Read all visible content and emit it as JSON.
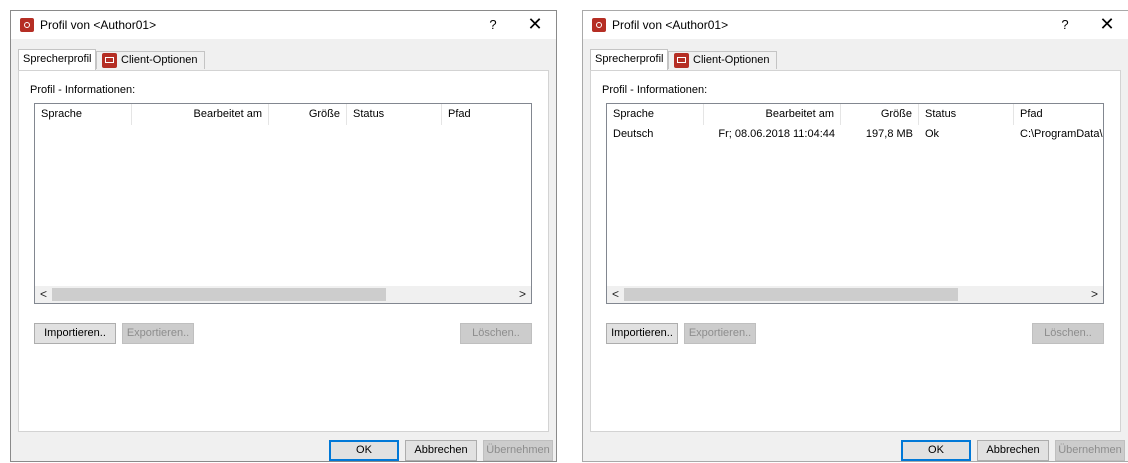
{
  "dialogs": [
    {
      "title": "Profil von <Author01>",
      "help_label": "?",
      "close_label": "✕",
      "tabs": [
        "Sprecherprofil",
        "Client-Optionen"
      ],
      "group_label": "Profil - Informationen:",
      "columns": [
        "Sprache",
        "Bearbeitet am",
        "Größe",
        "Status",
        "Pfad"
      ],
      "rows": [],
      "scroll_left": "<",
      "scroll_right": ">",
      "buttons": {
        "import": "Importieren..",
        "export": "Exportieren..",
        "delete": "Löschen.."
      },
      "footer": {
        "ok": "OK",
        "cancel": "Abbrechen",
        "apply": "Übernehmen"
      }
    },
    {
      "title": "Profil von <Author01>",
      "help_label": "?",
      "close_label": "✕",
      "tabs": [
        "Sprecherprofil",
        "Client-Optionen"
      ],
      "group_label": "Profil - Informationen:",
      "columns": [
        "Sprache",
        "Bearbeitet am",
        "Größe",
        "Status",
        "Pfad"
      ],
      "rows": [
        {
          "sprache": "Deutsch",
          "bearbeitet": "Fr; 08.06.2018 11:04:44",
          "groesse": "197,8 MB",
          "status": "Ok",
          "pfad": "C:\\ProgramData\\Sc"
        }
      ],
      "scroll_left": "<",
      "scroll_right": ">",
      "buttons": {
        "import": "Importieren..",
        "export": "Exportieren..",
        "delete": "Löschen.."
      },
      "footer": {
        "ok": "OK",
        "cancel": "Abbrechen",
        "apply": "Übernehmen"
      }
    }
  ]
}
